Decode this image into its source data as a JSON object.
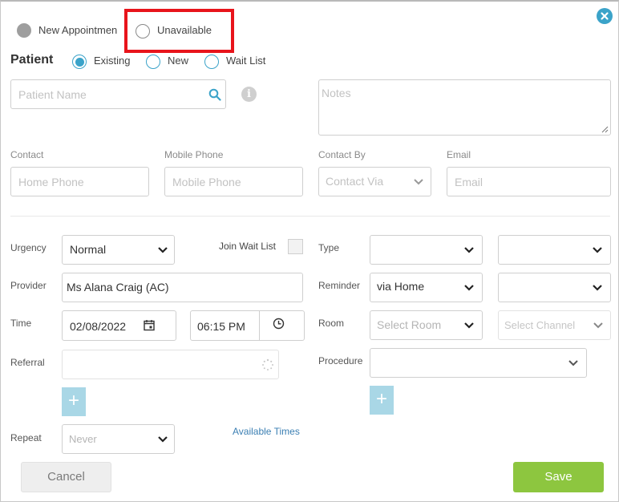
{
  "mode": {
    "new_appointment": "New Appointmen",
    "unavailable": "Unavailable"
  },
  "patient": {
    "heading": "Patient",
    "options": [
      "Existing",
      "New",
      "Wait List"
    ],
    "selected": "Existing",
    "name_placeholder": "Patient Name",
    "notes_placeholder": "Notes"
  },
  "contact": {
    "contact_label": "Contact",
    "mobile_label": "Mobile Phone",
    "contact_by_label": "Contact By",
    "email_label": "Email",
    "home_phone_placeholder": "Home Phone",
    "mobile_phone_placeholder": "Mobile Phone",
    "contact_via_placeholder": "Contact Via",
    "email_placeholder": "Email"
  },
  "details": {
    "urgency_label": "Urgency",
    "urgency_value": "Normal",
    "join_wait_list_label": "Join Wait List",
    "type_label": "Type",
    "provider_label": "Provider",
    "provider_value": "Ms Alana Craig (AC)",
    "reminder_label": "Reminder",
    "reminder_value": "via Home",
    "time_label": "Time",
    "date_value": "02/08/2022",
    "time_value": "06:15 PM",
    "room_label": "Room",
    "room_placeholder": "Select Room",
    "channel_placeholder": "Select Channel",
    "referral_label": "Referral",
    "procedure_label": "Procedure",
    "repeat_label": "Repeat",
    "repeat_placeholder": "Never",
    "available_times_link": "Available Times"
  },
  "actions": {
    "cancel": "Cancel",
    "save": "Save"
  },
  "colors": {
    "accent": "#3ba3c9",
    "save": "#8dc63f",
    "highlight": "#e8141b"
  }
}
